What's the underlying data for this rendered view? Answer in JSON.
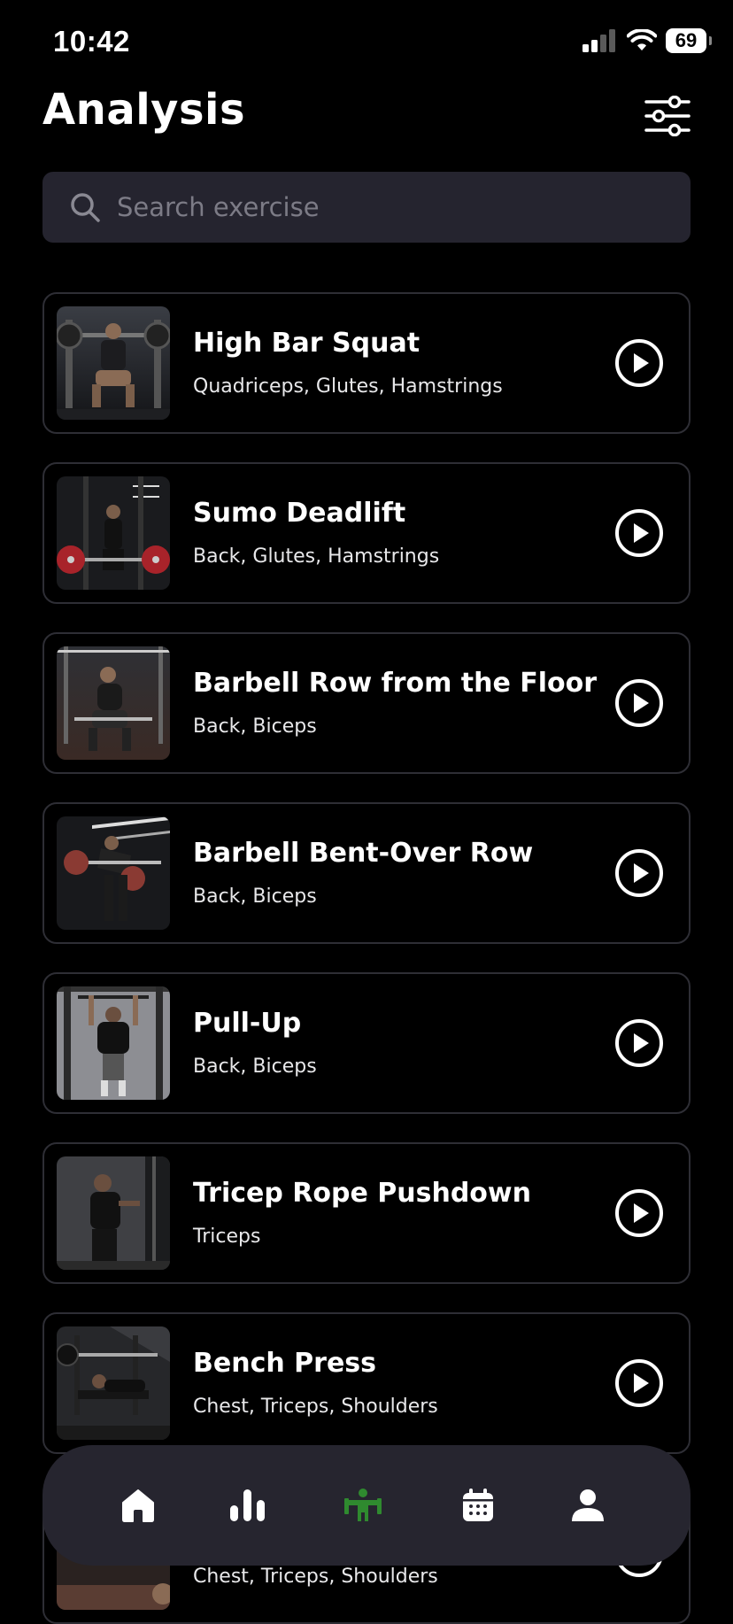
{
  "status": {
    "time": "10:42",
    "battery": "69"
  },
  "header": {
    "title": "Analysis",
    "filter_icon": "sliders-icon"
  },
  "search": {
    "placeholder": "Search exercise",
    "value": ""
  },
  "exercises": [
    {
      "name": "High Bar Squat",
      "muscles": "Quadriceps, Glutes, Hamstrings"
    },
    {
      "name": "Sumo Deadlift",
      "muscles": "Back, Glutes, Hamstrings"
    },
    {
      "name": "Barbell Row from the Floor",
      "muscles": "Back, Biceps"
    },
    {
      "name": "Barbell Bent-Over Row",
      "muscles": "Back, Biceps"
    },
    {
      "name": "Pull-Up",
      "muscles": "Back, Biceps"
    },
    {
      "name": "Tricep Rope Pushdown",
      "muscles": "Triceps"
    },
    {
      "name": "Bench Press",
      "muscles": "Chest, Triceps, Shoulders"
    },
    {
      "name": "",
      "muscles": "Chest, Triceps, Shoulders"
    }
  ],
  "nav": {
    "items": [
      {
        "icon": "home-icon",
        "active": false
      },
      {
        "icon": "bar-chart-icon",
        "active": false
      },
      {
        "icon": "body-analysis-icon",
        "active": true
      },
      {
        "icon": "calendar-icon",
        "active": false
      },
      {
        "icon": "profile-icon",
        "active": false
      }
    ],
    "active_color": "#2f8a2f",
    "inactive_color": "#ffffff"
  },
  "colors": {
    "background": "#000000",
    "card_border": "#2e2e35",
    "search_bg": "#25242f",
    "nav_bg": "#26252f"
  }
}
